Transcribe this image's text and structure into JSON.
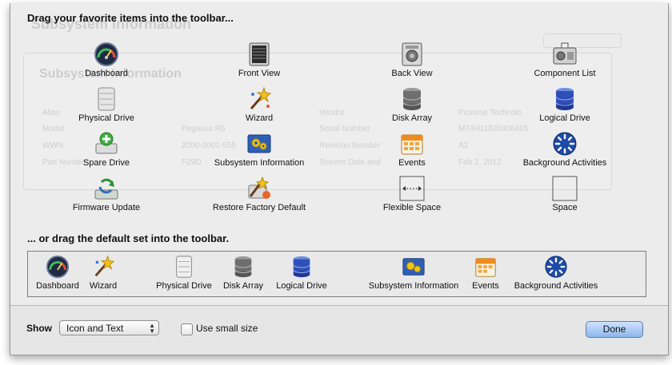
{
  "ghost": {
    "title": "Subsystem Information",
    "panel_title": "Subsystem Information",
    "rows": [
      "Alias",
      "Model",
      "WWN",
      "Part Number"
    ],
    "col2": [
      "Pegasus R6",
      "2000-0001-555",
      "F29D"
    ],
    "col3": [
      "Vendor",
      "Serial Number",
      "Revision Number",
      "System Date and"
    ],
    "col4": [
      "Promise Technolo",
      "M74H11820400465",
      "A2",
      "Feb 2, 2012"
    ]
  },
  "heading_favorites": "Drag your favorite items into the toolbar...",
  "heading_default": "... or drag the default set into the toolbar.",
  "favorites": [
    {
      "label": "Dashboard",
      "icon": "dashboard-gauge-icon"
    },
    {
      "label": "Front View",
      "icon": "front-view-icon"
    },
    {
      "label": "Back View",
      "icon": "back-view-icon"
    },
    {
      "label": "Component List",
      "icon": "component-list-icon"
    },
    {
      "label": "Physical Drive",
      "icon": "physical-drive-icon"
    },
    {
      "label": "Wizard",
      "icon": "wizard-wand-icon"
    },
    {
      "label": "Disk Array",
      "icon": "disk-array-icon"
    },
    {
      "label": "Logical Drive",
      "icon": "logical-drive-icon"
    },
    {
      "label": "Spare Drive",
      "icon": "spare-drive-icon"
    },
    {
      "label": "Subsystem Information",
      "icon": "subsystem-information-icon"
    },
    {
      "label": "Events",
      "icon": "events-calendar-icon"
    },
    {
      "label": "Background Activities",
      "icon": "background-activities-icon"
    },
    {
      "label": "Firmware Update",
      "icon": "firmware-update-icon"
    },
    {
      "label": "Restore Factory Default",
      "icon": "restore-factory-default-icon"
    },
    {
      "label": "Flexible Space",
      "icon": "flexible-space-icon"
    },
    {
      "label": "Space",
      "icon": "space-icon"
    }
  ],
  "default_set": [
    {
      "label": "Dashboard",
      "icon": "dashboard-gauge-icon"
    },
    {
      "label": "Wizard",
      "icon": "wizard-wand-icon"
    },
    {
      "label": "Physical Drive",
      "icon": "physical-drive-icon"
    },
    {
      "label": "Disk Array",
      "icon": "disk-array-icon"
    },
    {
      "label": "Logical Drive",
      "icon": "logical-drive-icon"
    },
    {
      "label": "Subsystem Information",
      "icon": "subsystem-information-icon"
    },
    {
      "label": "Events",
      "icon": "events-calendar-icon"
    },
    {
      "label": "Background Activities",
      "icon": "background-activities-icon"
    }
  ],
  "bottom": {
    "show_label": "Show",
    "show_value": "Icon and Text",
    "small_size_label": "Use small size",
    "small_size_checked": false,
    "done_label": "Done"
  }
}
